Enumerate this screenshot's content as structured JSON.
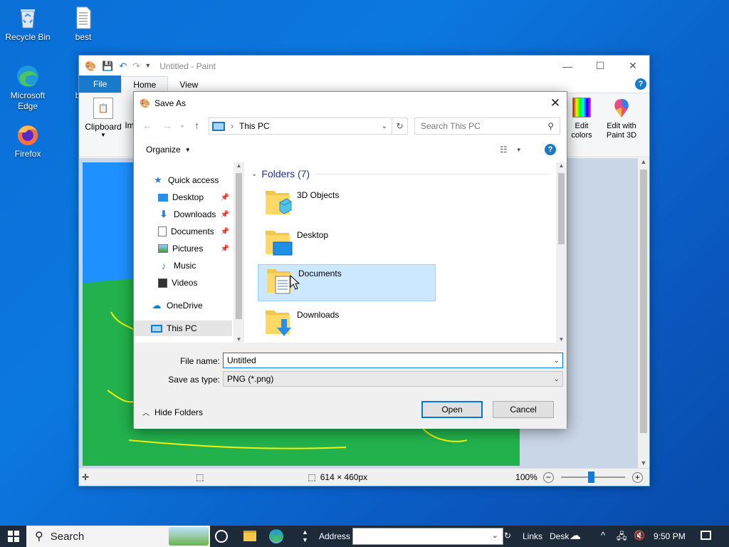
{
  "desktop": {
    "icons": [
      {
        "label": "Recycle Bin"
      },
      {
        "label": "best"
      },
      {
        "label": "Microsoft Edge"
      },
      {
        "label": "best"
      },
      {
        "label": "Firefox"
      }
    ]
  },
  "paint": {
    "title": "Untitled - Paint",
    "tabs": [
      "File",
      "Home",
      "View"
    ],
    "ribbon": {
      "clipboard": "Clipboard",
      "images_partial": "Im",
      "edit_colors": "Edit colors",
      "edit_paint3d": "Edit with Paint 3D"
    },
    "status": {
      "size": "614 × 460px",
      "zoom": "100%"
    }
  },
  "dialog": {
    "title": "Save As",
    "address": "This PC",
    "search_placeholder": "Search This PC",
    "organize": "Organize",
    "nav": {
      "quick_access": "Quick access",
      "items": [
        "Desktop",
        "Downloads",
        "Documents",
        "Pictures",
        "Music",
        "Videos"
      ],
      "onedrive": "OneDrive",
      "this_pc": "This PC"
    },
    "folders_header": "Folders (7)",
    "folders": [
      "3D Objects",
      "Desktop",
      "Documents",
      "Downloads"
    ],
    "file_name_label": "File name:",
    "file_name_value": "Untitled",
    "type_label": "Save as type:",
    "type_value": "PNG (*.png)",
    "hide_folders": "Hide Folders",
    "open": "Open",
    "cancel": "Cancel"
  },
  "taskbar": {
    "search": "Search",
    "address_label": "Address",
    "links": "Links",
    "desktop_partial": "Desk",
    "time": "9:50 PM"
  }
}
